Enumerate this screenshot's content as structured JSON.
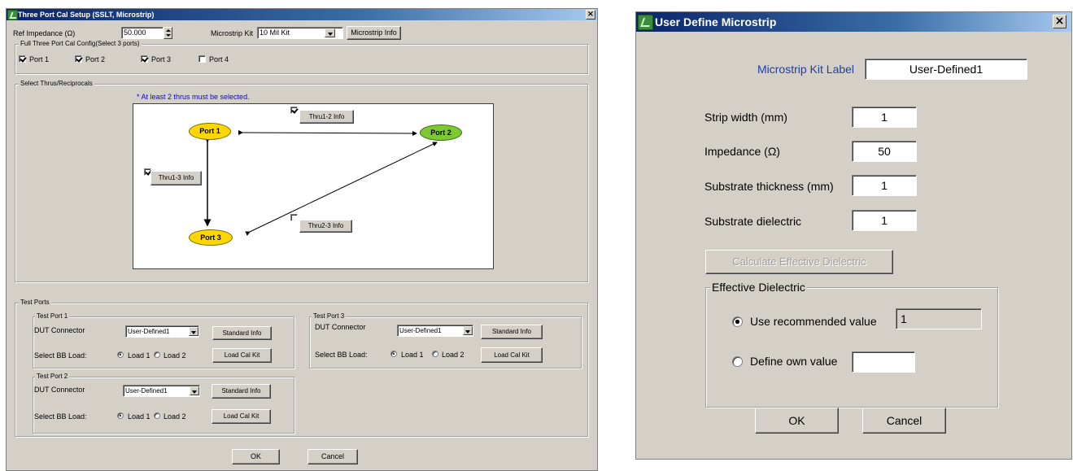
{
  "left": {
    "title": "Three Port Cal Setup (SSLT, Microstrip)",
    "close_glyph": "×",
    "ref_label": "Ref Impedance (Ω)",
    "ref_value": "50.000",
    "kit_label": "Microstrip Kit",
    "kit_value": "10 Mil Kit",
    "kit_info_btn": "Microstrip Info",
    "config_group": "Full Three Port Cal Config(Select 3 ports)",
    "ports": [
      {
        "label": "Port 1",
        "checked": true
      },
      {
        "label": "Port 2",
        "checked": true
      },
      {
        "label": "Port 3",
        "checked": true
      },
      {
        "label": "Port 4",
        "checked": false
      }
    ],
    "thrus_group": "Select Thrus/Reciprocals",
    "thrus_note": "* At least 2 thrus must be selected.",
    "node_port1": "Port 1",
    "node_port2": "Port 2",
    "node_port3": "Port 3",
    "thru12": {
      "label": "Thru1-2 Info",
      "checked": true
    },
    "thru13": {
      "label": "Thru1-3 Info",
      "checked": true
    },
    "thru23": {
      "label": "Thru2-3 Info",
      "checked": false
    },
    "test_ports_group": "Test Ports",
    "tp1": {
      "title": "Test Port 1",
      "dut": "DUT Connector",
      "conn": "User-Defined1",
      "std": "Standard Info",
      "bb": "Select BB Load:",
      "load1": "Load 1",
      "load2": "Load 2",
      "kit": "Load Cal Kit"
    },
    "tp2": {
      "title": "Test Port 2",
      "dut": "DUT Connector",
      "conn": "User-Defined1",
      "std": "Standard Info",
      "bb": "Select BB Load:",
      "load1": "Load 1",
      "load2": "Load 2",
      "kit": "Load Cal Kit"
    },
    "tp3": {
      "title": "Test Port 3",
      "dut": "DUT Connector",
      "conn": "User-Defined1",
      "std": "Standard Info",
      "bb": "Select BB Load:",
      "load1": "Load 1",
      "load2": "Load 2",
      "kit": "Load Cal Kit"
    },
    "ok": "OK",
    "cancel": "Cancel"
  },
  "right": {
    "title": "User Define Microstrip",
    "close_glyph": "×",
    "kit_label_text": "Microstrip Kit Label",
    "kit_label_value": "User-Defined1",
    "strip_width_label": "Strip width (mm)",
    "strip_width_value": "1",
    "impedance_label": "Impedance (Ω)",
    "impedance_value": "50",
    "thickness_label": "Substrate thickness (mm)",
    "thickness_value": "1",
    "dielectric_label": "Substrate dielectric",
    "dielectric_value": "1",
    "calc_btn": "Calculate Effective Dielectric",
    "eff_group": "Effective Dielectric",
    "use_recommended": "Use recommended value",
    "recommended_value": "1",
    "define_own": "Define own value",
    "own_value": "",
    "ok": "OK",
    "cancel": "Cancel"
  },
  "colors": {
    "port_yellow": "#ffd700",
    "port_green": "#7ec832",
    "note_blue": "#0000ff",
    "kit_label_blue": "#1f3f9f"
  }
}
